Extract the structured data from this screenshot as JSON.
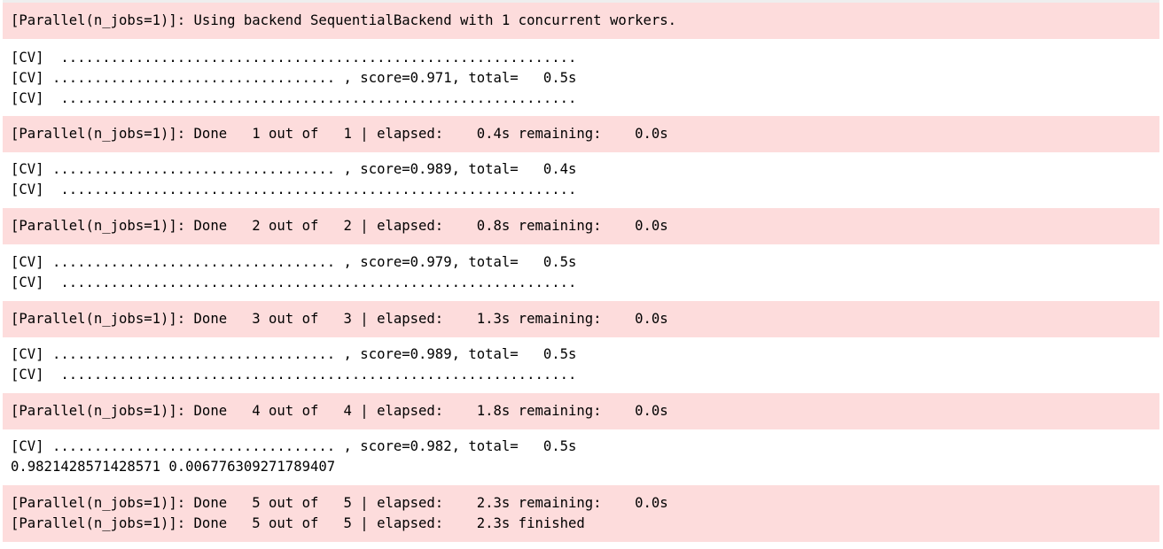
{
  "blocks": [
    {
      "kind": "stderr",
      "lines": [
        "[Parallel(n_jobs=1)]: Using backend SequentialBackend with 1 concurrent workers."
      ]
    },
    {
      "kind": "stdout",
      "lines": [
        "[CV]  ..............................................................",
        "[CV] .................................. , score=0.971, total=   0.5s",
        "[CV]  .............................................................."
      ]
    },
    {
      "kind": "stderr",
      "lines": [
        "[Parallel(n_jobs=1)]: Done   1 out of   1 | elapsed:    0.4s remaining:    0.0s"
      ]
    },
    {
      "kind": "stdout",
      "lines": [
        "[CV] .................................. , score=0.989, total=   0.4s",
        "[CV]  .............................................................."
      ]
    },
    {
      "kind": "stderr",
      "lines": [
        "[Parallel(n_jobs=1)]: Done   2 out of   2 | elapsed:    0.8s remaining:    0.0s"
      ]
    },
    {
      "kind": "stdout",
      "lines": [
        "[CV] .................................. , score=0.979, total=   0.5s",
        "[CV]  .............................................................."
      ]
    },
    {
      "kind": "stderr",
      "lines": [
        "[Parallel(n_jobs=1)]: Done   3 out of   3 | elapsed:    1.3s remaining:    0.0s"
      ]
    },
    {
      "kind": "stdout",
      "lines": [
        "[CV] .................................. , score=0.989, total=   0.5s",
        "[CV]  .............................................................."
      ]
    },
    {
      "kind": "stderr",
      "lines": [
        "[Parallel(n_jobs=1)]: Done   4 out of   4 | elapsed:    1.8s remaining:    0.0s"
      ]
    },
    {
      "kind": "stdout",
      "lines": [
        "[CV] .................................. , score=0.982, total=   0.5s",
        "0.9821428571428571 0.006776309271789407"
      ]
    },
    {
      "kind": "stderr",
      "lines": [
        "[Parallel(n_jobs=1)]: Done   5 out of   5 | elapsed:    2.3s remaining:    0.0s",
        "[Parallel(n_jobs=1)]: Done   5 out of   5 | elapsed:    2.3s finished"
      ]
    }
  ],
  "colors": {
    "stderr_background": "#fddcdc",
    "stdout_background": "#ffffff",
    "text": "#000000"
  }
}
